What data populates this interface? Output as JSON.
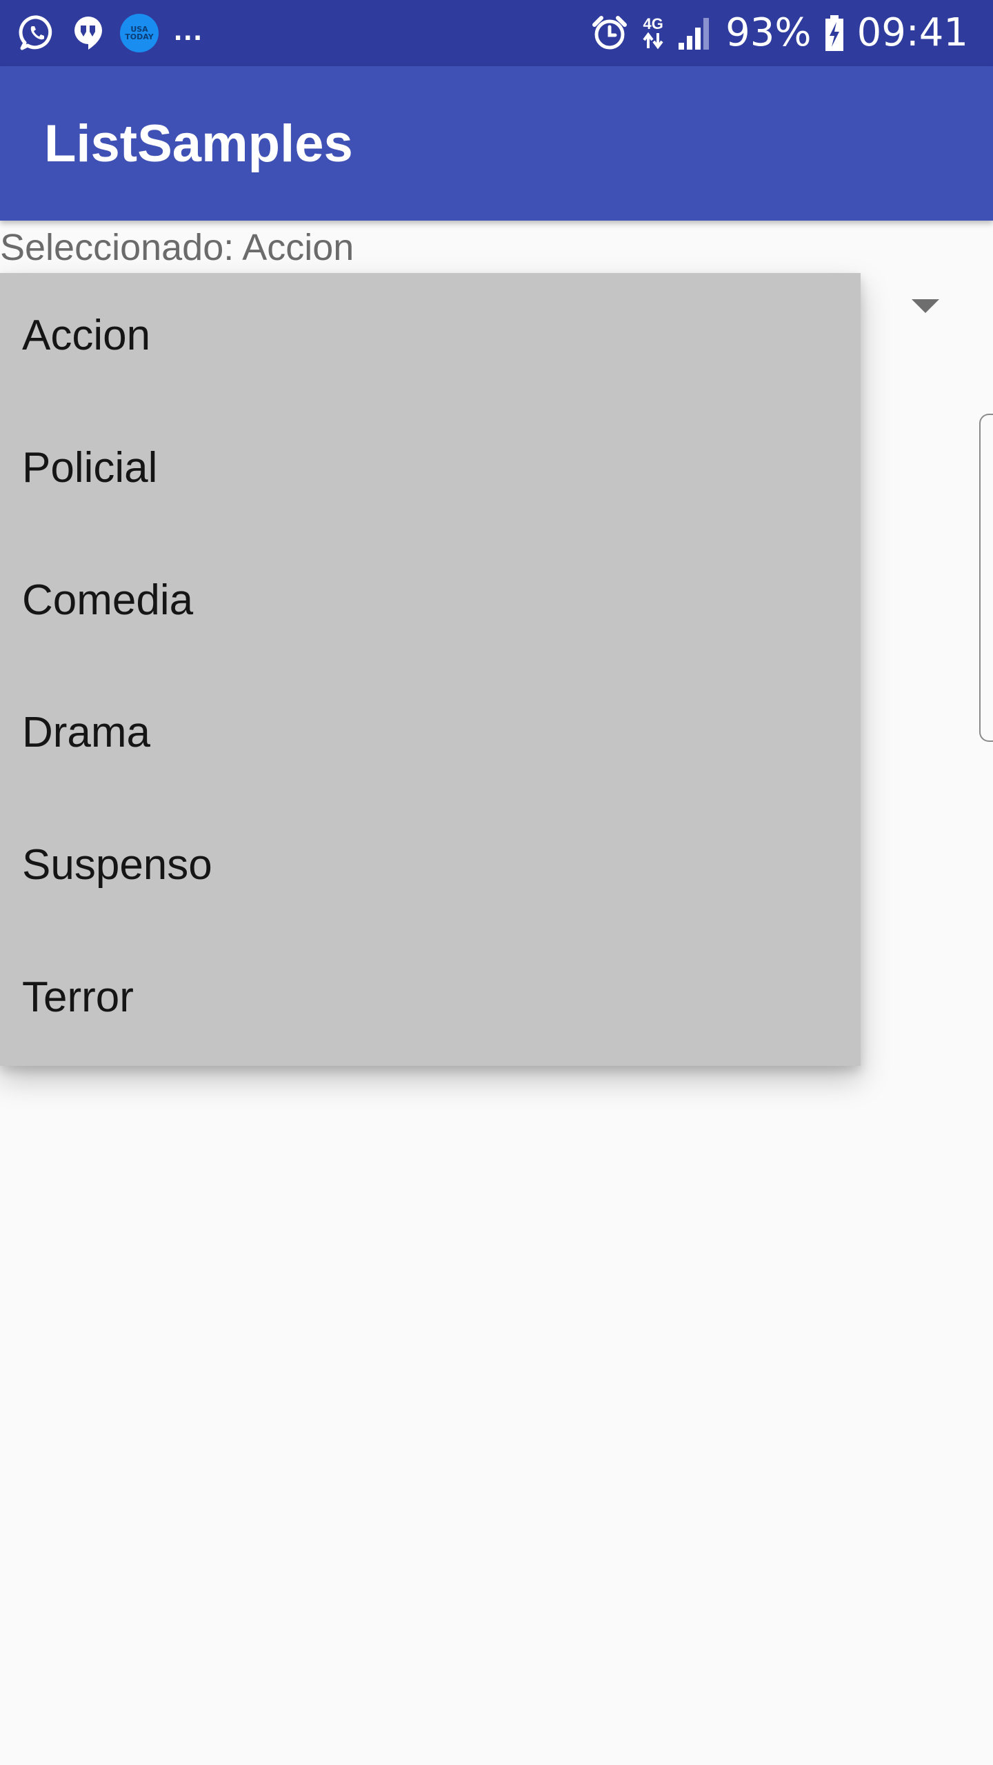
{
  "status_bar": {
    "left_icons": [
      "whatsapp-icon",
      "hangouts-icon",
      "usa-today-icon"
    ],
    "usa_today_badge": "USA TODAY",
    "overflow_indicator": "...",
    "right_icons": [
      "alarm-icon",
      "data-arrows-icon",
      "signal-icon",
      "battery-charging-icon"
    ],
    "network_label": "4G",
    "battery_percent": "93%",
    "time": "09:41",
    "background_color": "#2f3c9e"
  },
  "app_bar": {
    "title": "ListSamples",
    "background_color": "#3f51b5"
  },
  "content": {
    "selected_text": "Seleccionado: Accion"
  },
  "spinner": {
    "arrow_icon": "dropdown-arrow-icon",
    "selected_value": "Accion",
    "options": [
      "Accion",
      "Policial",
      "Comedia",
      "Drama",
      "Suspenso",
      "Terror"
    ],
    "popup_color": "#c4c4c4"
  }
}
